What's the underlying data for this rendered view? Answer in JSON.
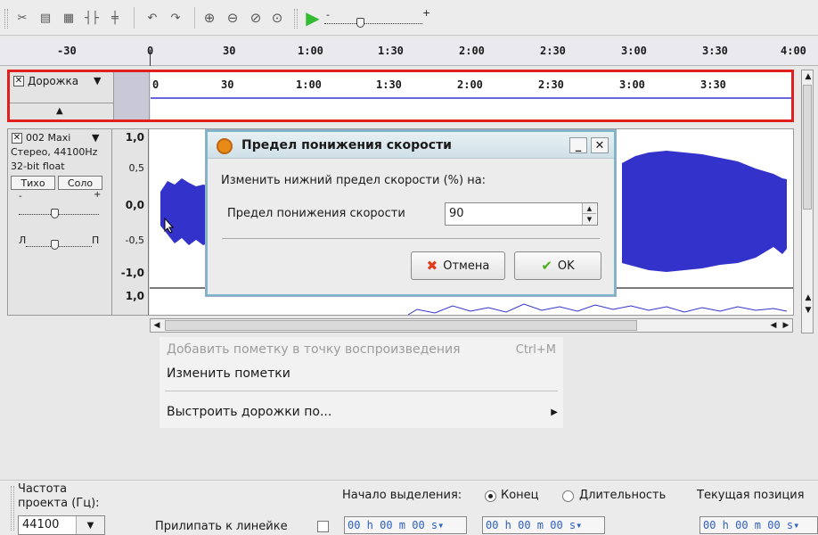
{
  "toolbar": {
    "icons": [
      "trim-icon",
      "silence-icon",
      "paste-icon",
      "join-icon",
      "split-icon",
      "undo-icon",
      "redo-icon",
      "zoom-in-icon",
      "zoom-out-icon",
      "fit-selection-icon",
      "fit-project-icon",
      "play-at-speed-icon",
      "speed-slider"
    ],
    "speed_slider_minus": "-",
    "speed_slider_plus": "+"
  },
  "ruler": {
    "labels": [
      "-30",
      "0",
      "30",
      "1:00",
      "1:30",
      "2:00",
      "2:30",
      "3:00",
      "3:30",
      "4:00"
    ]
  },
  "label_track": {
    "name": "Дорожка",
    "collapse_symbol": "▲",
    "ruler_labels": [
      "0",
      "30",
      "1:00",
      "1:30",
      "2:00",
      "2:30",
      "3:00",
      "3:30"
    ]
  },
  "audio_track": {
    "name": "002 Maxi",
    "info_line1": "Стерео, 44100Hz",
    "info_line2": "32-bit float",
    "mute_label": "Тихо",
    "solo_label": "Соло",
    "gain_minus": "-",
    "gain_plus": "+",
    "pan_left": "Л",
    "pan_right": "П",
    "scale": [
      "1,0",
      "0,5",
      "0,0",
      "-0,5",
      "-1,0",
      "1,0"
    ]
  },
  "context_menu": {
    "items": [
      {
        "label": "Добавить пометку в точку воспроизведения",
        "shortcut": "Ctrl+M",
        "enabled": false
      },
      {
        "label": "Изменить пометки",
        "enabled": true
      },
      {
        "label": "Выстроить дорожки по...",
        "enabled": true,
        "submenu": true
      }
    ]
  },
  "dialog": {
    "title": "Предел понижения скорости",
    "prompt": "Изменить нижний предел скорости (%) на:",
    "field_label": "Предел понижения скорости",
    "field_value": "90",
    "cancel_label": "Отмена",
    "ok_label": "OK",
    "minimize_symbol": "_",
    "close_symbol": "✕"
  },
  "bottom_bar": {
    "rate_label_line1": "Частота",
    "rate_label_line2": "проекта (Гц):",
    "rate_value": "44100",
    "snap_label": "Прилипать к линейке",
    "selection_start_label": "Начало выделения:",
    "end_label": "Конец",
    "length_label": "Длительность",
    "current_position_label": "Текущая позиция",
    "time_value": "00 h 00 m 00 s"
  },
  "colors": {
    "selection_border": "#e01f1f",
    "waveform": "#3333cc",
    "time_text": "#3060c0",
    "play_green": "#33bb33"
  }
}
